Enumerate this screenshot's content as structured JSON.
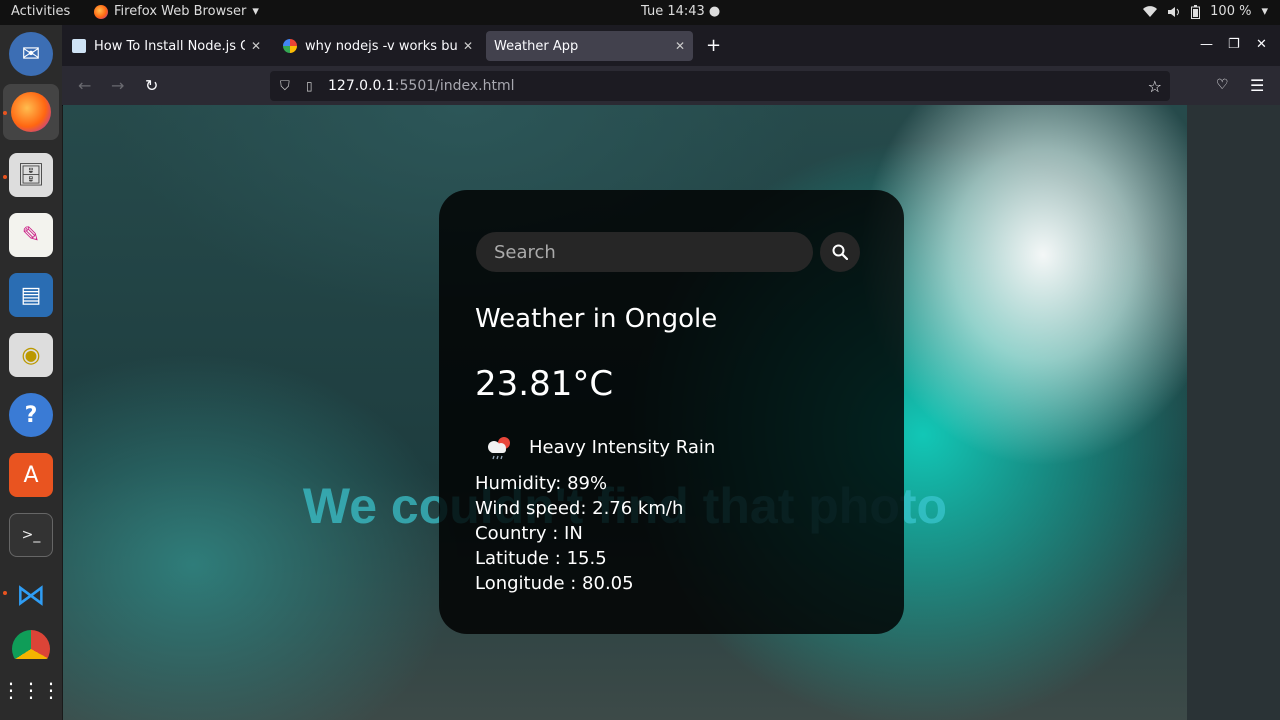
{
  "os": {
    "activities": "Activities",
    "app_name": "Firefox Web Browser",
    "clock": "Tue 14:43 ●",
    "battery": "100 %"
  },
  "browser": {
    "tabs": [
      {
        "title": "How To Install Node.js On"
      },
      {
        "title": "why nodejs -v works but r"
      },
      {
        "title": "Weather App"
      }
    ],
    "url_host": "127.0.0.1",
    "url_path": ":5501/index.html"
  },
  "page": {
    "background_error": "We couldn't find that photo",
    "search": {
      "placeholder": "Search"
    },
    "city": "Weather in Ongole",
    "temperature": "23.81°C",
    "description": "Heavy Intensity Rain",
    "humidity": "Humidity: 89%",
    "wind": "Wind speed: 2.76 km/h",
    "country": "Country : IN",
    "latitude": "Latitude : 15.5",
    "longitude": "Longitude : 80.05"
  }
}
